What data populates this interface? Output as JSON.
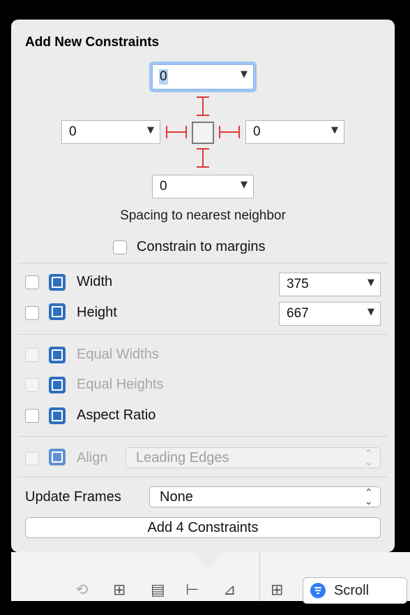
{
  "popover": {
    "title": "Add New Constraints",
    "spacing": {
      "top": "0",
      "left": "0",
      "right": "0",
      "bottom": "0",
      "caption": "Spacing to nearest neighbor",
      "constrain_margins_label": "Constrain to margins",
      "constrain_margins_checked": false
    },
    "size": {
      "width_label": "Width",
      "width_value": "375",
      "width_checked": false,
      "height_label": "Height",
      "height_value": "667",
      "height_checked": false
    },
    "equal": {
      "equal_widths_label": "Equal Widths",
      "equal_heights_label": "Equal Heights",
      "aspect_ratio_label": "Aspect Ratio"
    },
    "align": {
      "label": "Align",
      "selected": "Leading Edges"
    },
    "update_frames": {
      "label": "Update Frames",
      "selected": "None"
    },
    "add_button_label": "Add 4 Constraints"
  },
  "toolbar": {
    "scroll_label": "Scroll",
    "icons": [
      "refresh-icon",
      "stack-icon",
      "align-icon",
      "pin-icon",
      "resolve-icon",
      "embed-icon",
      "filter-icon"
    ]
  },
  "colors": {
    "accent_blue": "#2f6fbf",
    "constraint_red": "#e13a3a",
    "focus_ring": "#9fc4f2"
  }
}
